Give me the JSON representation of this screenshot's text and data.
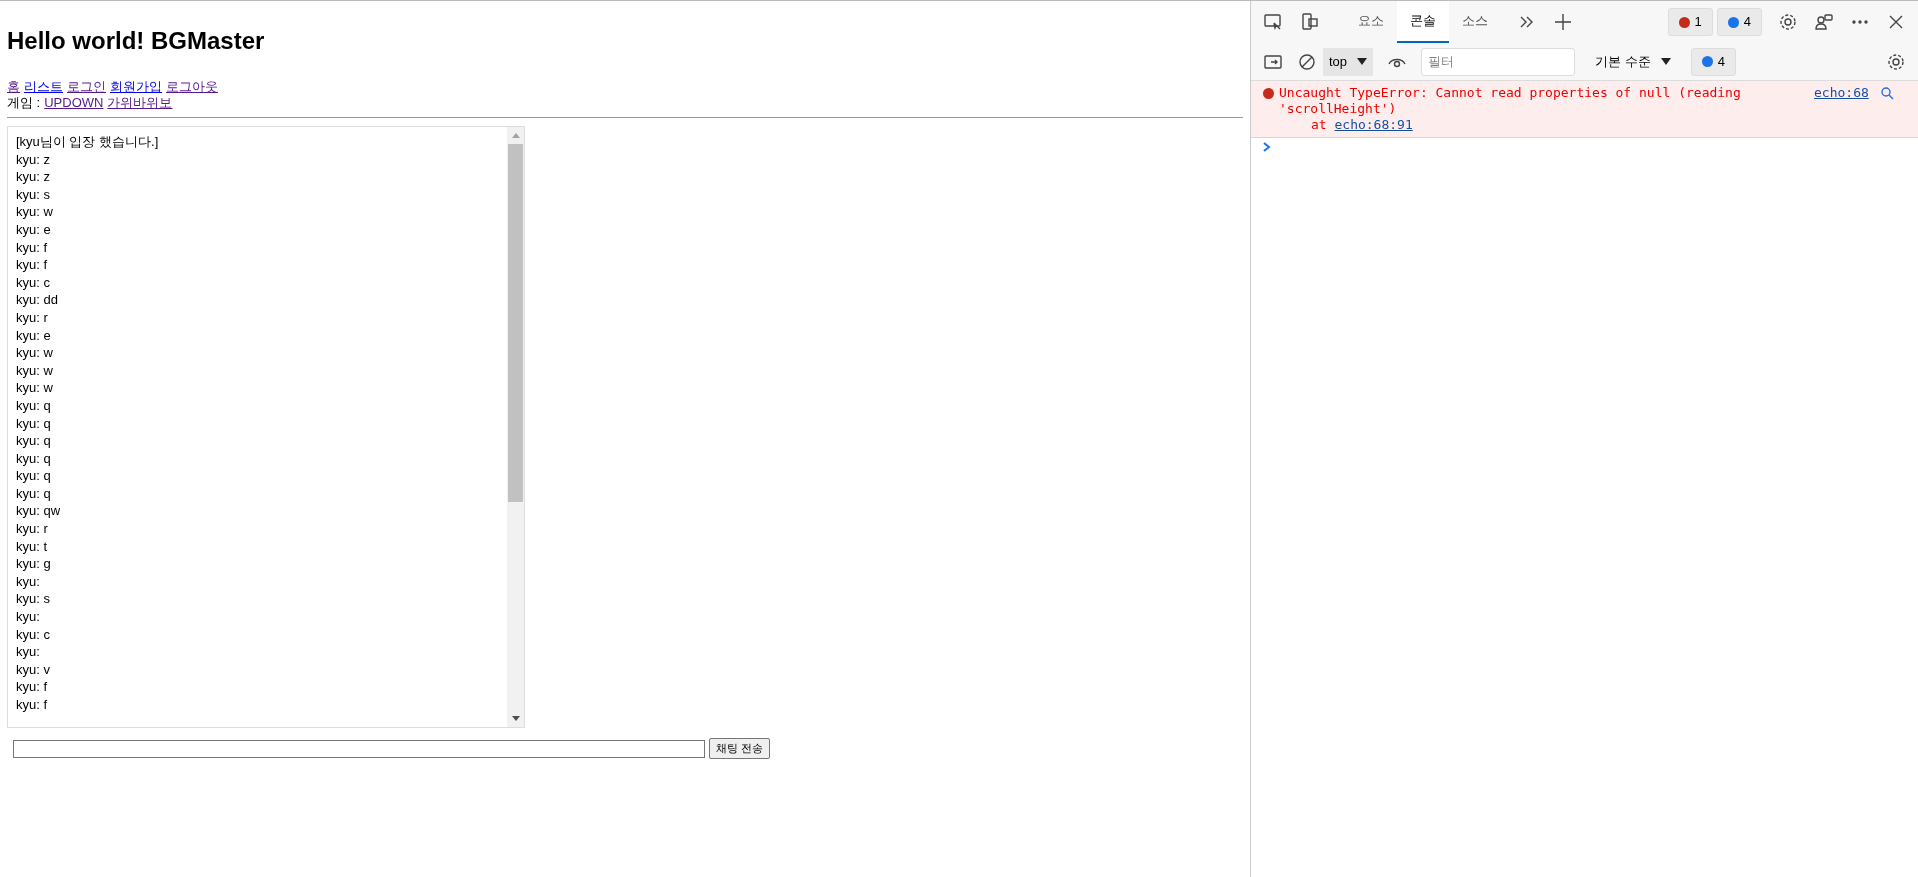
{
  "page": {
    "heading": "Hello world! BGMaster",
    "nav_links": [
      {
        "label": "홈",
        "visited": true
      },
      {
        "label": "리스트",
        "visited": false
      },
      {
        "label": "로그인",
        "visited": true
      },
      {
        "label": "회원가입",
        "visited": false
      },
      {
        "label": "로그아웃",
        "visited": true
      }
    ],
    "game_label": "게임 :",
    "game_links": [
      {
        "label": "UPDOWN",
        "visited": true
      },
      {
        "label": "가위바위보",
        "visited": true
      }
    ],
    "chat_messages": [
      "[kyu님이 입장 했습니다.]",
      "kyu: z",
      "kyu: z",
      "kyu: s",
      "kyu: w",
      "kyu: e",
      "kyu: f",
      "kyu: f",
      "kyu: c",
      "kyu: dd",
      "kyu: r",
      "kyu: e",
      "kyu: w",
      "kyu: w",
      "kyu: w",
      "kyu: q",
      "kyu: q",
      "kyu: q",
      "kyu: q",
      "kyu: q",
      "kyu: q",
      "kyu: qw",
      "kyu: r",
      "kyu: t",
      "kyu: g",
      "kyu:",
      "kyu: s",
      "kyu:",
      "kyu: c",
      "kyu:",
      "kyu: v",
      "kyu: f",
      "kyu: f"
    ],
    "send_button": "채팅 전송"
  },
  "devtools": {
    "tabs": [
      {
        "label": "요소",
        "selected": false
      },
      {
        "label": "콘솔",
        "selected": true
      },
      {
        "label": "소스",
        "selected": false
      }
    ],
    "error_count": "1",
    "message_count": "4",
    "context": "top",
    "filter_placeholder": "필터",
    "level_select": "기본 수준",
    "filter_message_count": "4",
    "error": {
      "message": "Uncaught TypeError: Cannot read properties of null (reading 'scrollHeight')",
      "source": "echo:68",
      "stack_prefix": "at",
      "stack_link": "echo:68:91"
    }
  }
}
